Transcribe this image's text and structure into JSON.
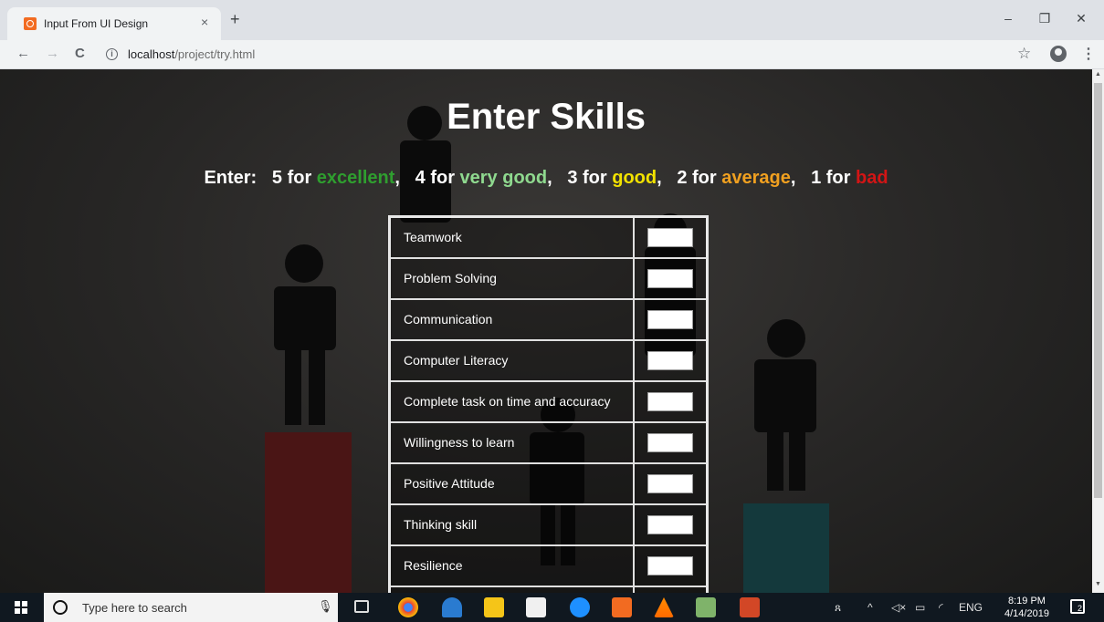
{
  "browser": {
    "tab_title": "Input From UI Design",
    "tab_close": "×",
    "new_tab": "+",
    "url_host": "localhost",
    "url_path": "/project/try.html",
    "window_controls": [
      "–",
      "❐",
      "✕"
    ],
    "back": "←",
    "forward": "→",
    "reload": "C",
    "star": "☆",
    "menu": "⋮"
  },
  "page": {
    "heading": "Enter Skills",
    "legend": {
      "prefix": "Enter:   5 for ",
      "excellent": "excellent",
      "sep1": ",   4 for ",
      "very_good": "very good",
      "sep2": ",   3 for ",
      "good": "good",
      "sep3": ",   2 for ",
      "average": "average",
      "sep4": ",   1 for ",
      "bad": "bad"
    },
    "skills": [
      "Teamwork",
      "Problem Solving",
      "Communication",
      "Computer Literacy",
      "Complete task on time and accuracy",
      "Willingness to learn",
      "Positive Attitude",
      "Thinking skill",
      "Resilience",
      ""
    ]
  },
  "taskbar": {
    "search_placeholder": "Type here to search",
    "tray_lang": "ENG",
    "time": "8:19 PM",
    "date": "4/14/2019",
    "notification_count": "2"
  },
  "colors": {
    "excellent": "#2f9e2f",
    "very_good": "#8fd98f",
    "good": "#f2e200",
    "average": "#f0a020",
    "bad": "#d21515"
  }
}
